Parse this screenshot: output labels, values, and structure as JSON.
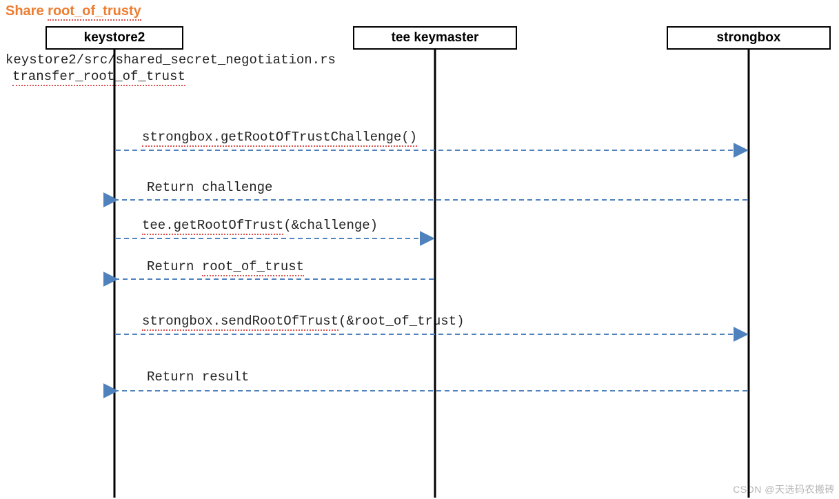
{
  "title": {
    "prefix": "Share ",
    "root": "root_of_trusty"
  },
  "lifelines": {
    "keystore2": {
      "label": "keystore2"
    },
    "tee": {
      "label": "tee keymaster"
    },
    "strongbox": {
      "label": "strongbox"
    }
  },
  "notes": {
    "file": "keystore2/src/shared_secret_negotiation.rs",
    "func": "transfer_root_of_trust"
  },
  "messages": {
    "m1": "strongbox.getRootOfTrustChallenge()",
    "m2": "Return challenge",
    "m3_a": "tee.getRootOfTrust",
    "m3_b": "(&challenge)",
    "m4_a": "Return ",
    "m4_b": "root_of_trust",
    "m5_a": "strongbox.sendRootOfTrust",
    "m5_b": "(&root_of_trust)",
    "m6": "Return result"
  },
  "watermark": "CSDN @天选码农搬砖",
  "chart_data": {
    "type": "sequence",
    "title": "Share root_of_trusty",
    "participants": [
      "keystore2",
      "tee keymaster",
      "strongbox"
    ],
    "context": {
      "file": "keystore2/src/shared_secret_negotiation.rs",
      "function": "transfer_root_of_trust"
    },
    "messages": [
      {
        "from": "keystore2",
        "to": "strongbox",
        "label": "strongbox.getRootOfTrustChallenge()",
        "style": "dashed",
        "dir": "request"
      },
      {
        "from": "strongbox",
        "to": "keystore2",
        "label": "Return challenge",
        "style": "dashed",
        "dir": "response"
      },
      {
        "from": "keystore2",
        "to": "tee keymaster",
        "label": "tee.getRootOfTrust(&challenge)",
        "style": "dashed",
        "dir": "request"
      },
      {
        "from": "tee keymaster",
        "to": "keystore2",
        "label": "Return root_of_trust",
        "style": "dashed",
        "dir": "response"
      },
      {
        "from": "keystore2",
        "to": "strongbox",
        "label": "strongbox.sendRootOfTrust(&root_of_trust)",
        "style": "dashed",
        "dir": "request"
      },
      {
        "from": "strongbox",
        "to": "keystore2",
        "label": "Return result",
        "style": "dashed",
        "dir": "response"
      }
    ]
  }
}
